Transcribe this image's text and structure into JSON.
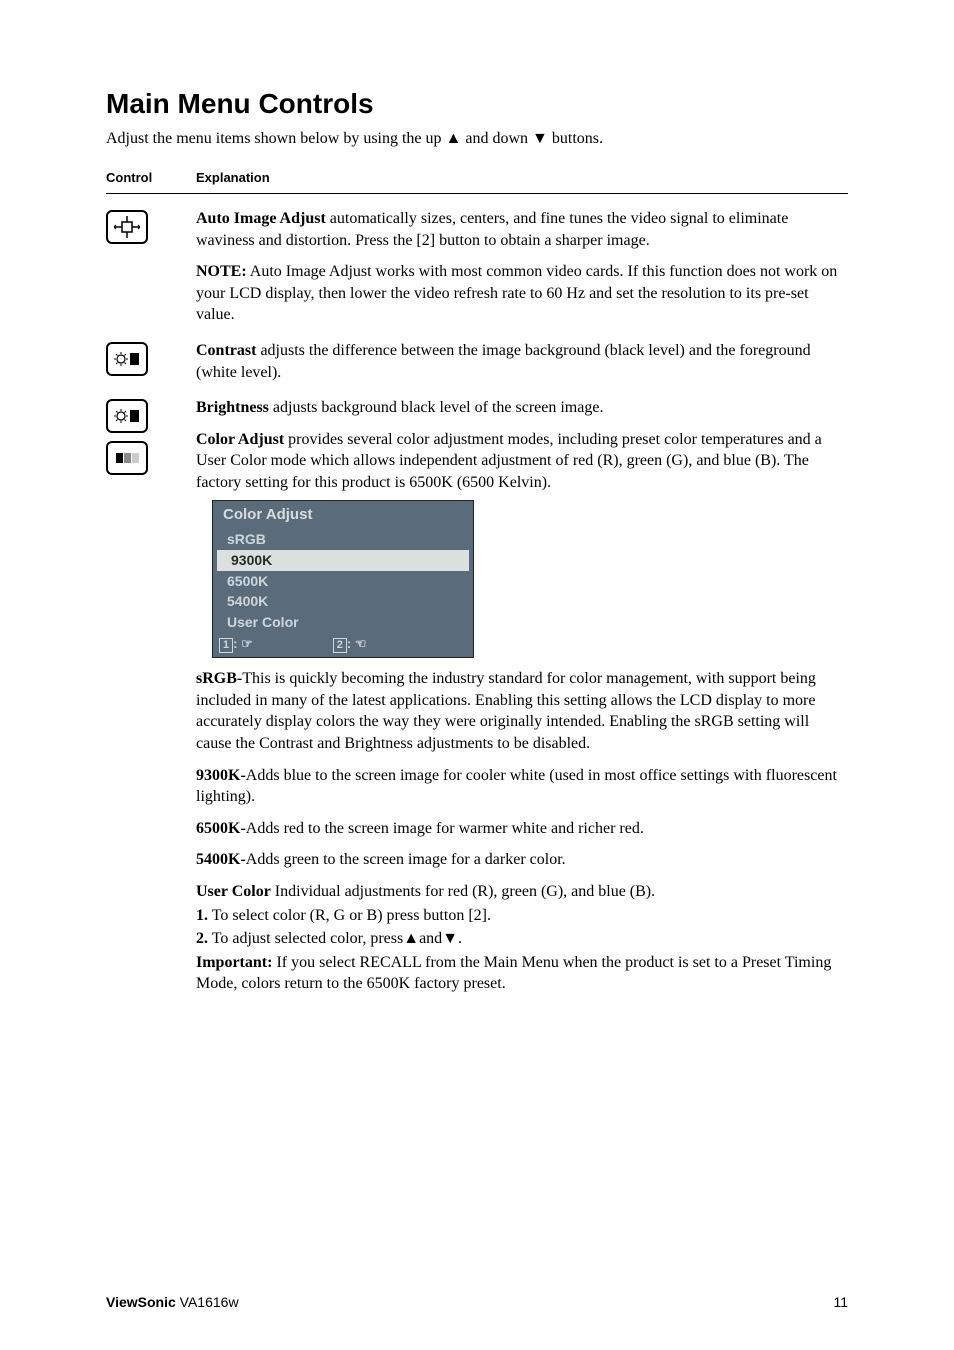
{
  "title": "Main Menu Controls",
  "intro_before": "Adjust the menu items shown below by using the up ",
  "intro_up": "▲",
  "intro_mid": " and down ",
  "intro_down": "▼",
  "intro_after": " buttons.",
  "headers": {
    "control": "Control",
    "explanation": "Explanation"
  },
  "auto_image": {
    "label": "Auto Image Adjust",
    "text": " automatically sizes, centers, and fine tunes the video signal to eliminate waviness and distortion. Press the [2] button to obtain a sharper image.",
    "note_label": "NOTE:",
    "note_text": " Auto Image Adjust works with most common video cards. If this function does not work on your LCD display, then lower the video refresh rate to 60 Hz and set the resolution to its pre-set value."
  },
  "contrast": {
    "label": "Contrast",
    "text": " adjusts the difference between the image background  (black level) and the foreground (white level)."
  },
  "brightness": {
    "label": "Brightness",
    "text": " adjusts background black level of the screen image."
  },
  "color_adjust": {
    "label": "Color Adjust",
    "text": " provides several color adjustment modes, including preset color temperatures and a User Color mode which allows independent adjustment of red (R), green (G), and blue (B). The factory setting for this product is 6500K (6500 Kelvin)."
  },
  "osd": {
    "title": "Color Adjust",
    "items": [
      "sRGB",
      "9300K",
      "6500K",
      "5400K",
      "User Color"
    ],
    "key1": "1",
    "key2": "2",
    "exit": ": ☞",
    "back": ": ☜"
  },
  "srgb": {
    "label": "sRGB-",
    "text": "This is quickly becoming the industry standard for color management, with support being included in many of the latest applications. Enabling this setting allows the LCD display to more accurately display colors the way they were originally intended. Enabling the sRGB setting will cause the Contrast and Brightness adjustments to be disabled."
  },
  "k9300": {
    "label": "9300K-",
    "text": "Adds blue to the screen image for cooler white (used in most office settings with fluorescent lighting)."
  },
  "k6500": {
    "label": "6500K-",
    "text": "Adds red to the screen image for warmer white and richer red."
  },
  "k5400": {
    "label": "5400K-",
    "text": "Adds green to the screen image for a darker color."
  },
  "user_color": {
    "label": "User Color",
    "text": "  Individual adjustments for red (R), green (G),  and blue (B).",
    "step1_label": "1.",
    "step1_text": " To select color (R, G or B) press button [2].",
    "step2_label": "2.",
    "step2_pre": " To adjust selected color, press",
    "step2_up": "▲",
    "step2_and": "and",
    "step2_down": "▼",
    "step2_dot": ".",
    "important_label": "Important:",
    "important_text": " If you select RECALL from the Main Menu when the product is set to a Preset Timing Mode, colors return to the 6500K factory preset."
  },
  "footer": {
    "brand": "ViewSonic",
    "model": "   VA1616w",
    "page": "11"
  }
}
